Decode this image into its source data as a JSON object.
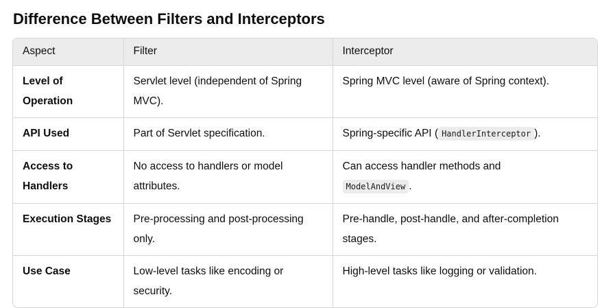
{
  "title": "Difference Between Filters and Interceptors",
  "table": {
    "headers": [
      "Aspect",
      "Filter",
      "Interceptor"
    ],
    "rows": [
      {
        "aspect": "Level of Operation",
        "filter": "Servlet level (independent of Spring MVC).",
        "interceptor": "Spring MVC level (aware of Spring context)."
      },
      {
        "aspect": "API Used",
        "filter": "Part of Servlet specification.",
        "interceptor_pre": "Spring-specific API (",
        "interceptor_code": "HandlerInterceptor",
        "interceptor_post": ")."
      },
      {
        "aspect": "Access to Handlers",
        "filter": "No access to handlers or model attributes.",
        "interceptor_pre": "Can access handler methods and ",
        "interceptor_code": "ModelAndView",
        "interceptor_post": "."
      },
      {
        "aspect": "Execution Stages",
        "filter": "Pre-processing and post-processing only.",
        "interceptor": "Pre-handle, post-handle, and after-completion stages."
      },
      {
        "aspect": "Use Case",
        "filter": "Low-level tasks like encoding or security.",
        "interceptor": "High-level tasks like logging or validation."
      }
    ]
  }
}
